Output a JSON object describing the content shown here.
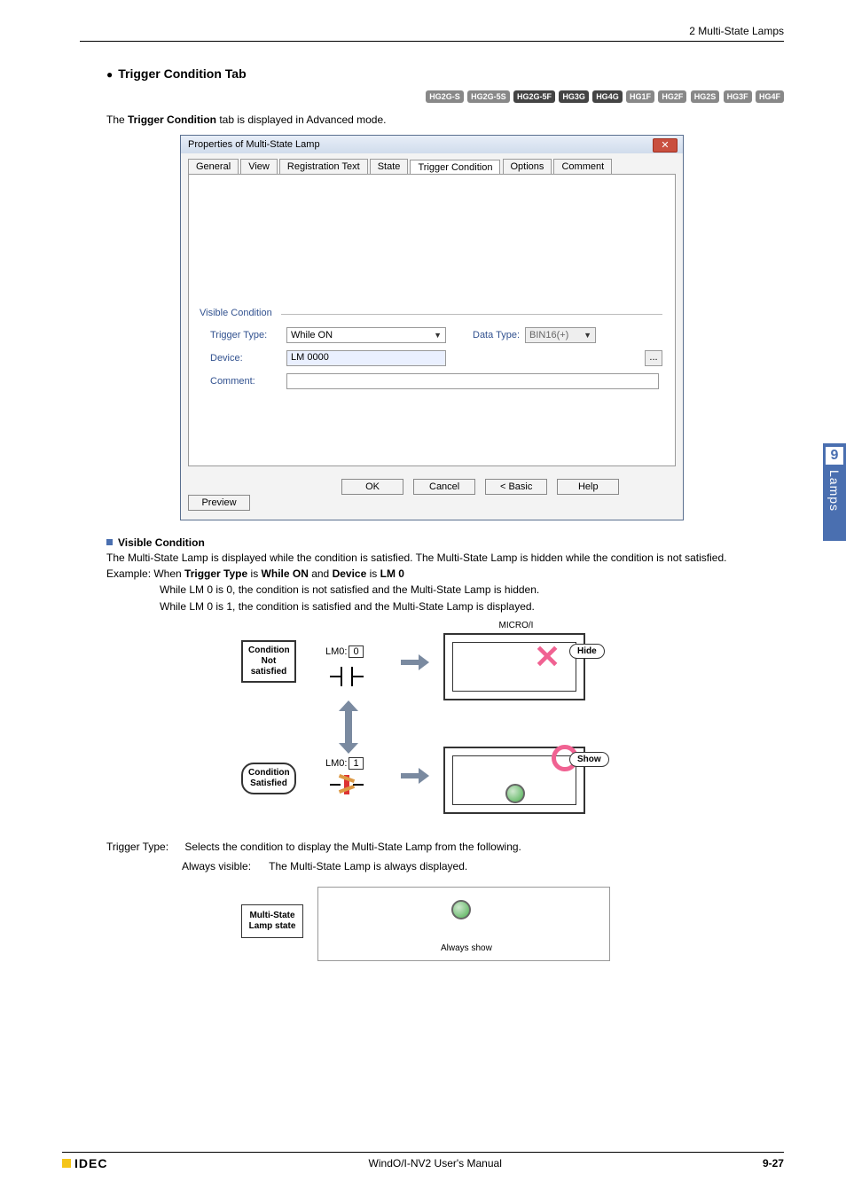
{
  "header": {
    "breadcrumb": "2 Multi-State Lamps"
  },
  "section": {
    "title_prefix": "Trigger Condition",
    "title_suffix": " Tab"
  },
  "badges": [
    "HG2G-S",
    "HG2G-5S",
    "HG2G-5F",
    "HG3G",
    "HG4G",
    "HG1F",
    "HG2F",
    "HG2S",
    "HG3F",
    "HG4F"
  ],
  "intro": {
    "p1a": "The ",
    "p1b": "Trigger Condition",
    "p1c": " tab is displayed in Advanced mode."
  },
  "dialog": {
    "title": "Properties of Multi-State Lamp",
    "tabs": [
      "General",
      "View",
      "Registration Text",
      "State",
      "Trigger Condition",
      "Options",
      "Comment"
    ],
    "active_tab_index": 4,
    "fieldset": "Visible Condition",
    "labels": {
      "trigger": "Trigger Type:",
      "device": "Device:",
      "comment": "Comment:",
      "datatype": "Data Type:"
    },
    "values": {
      "trigger": "While ON",
      "device": "LM 0000",
      "datatype": "BIN16(+)",
      "comment": ""
    },
    "buttons": {
      "ok": "OK",
      "cancel": "Cancel",
      "basic": "< Basic",
      "help": "Help",
      "preview": "Preview"
    },
    "browse": "..."
  },
  "visibleCondition": {
    "heading": "Visible Condition",
    "body": "The Multi-State Lamp is displayed while the condition is satisfied. The Multi-State Lamp is hidden while the condition is not satisfied.",
    "example_prefix": "Example: When ",
    "ex_b1": "Trigger Type",
    "ex_mid1": " is ",
    "ex_b2": "While ON",
    "ex_mid2": " and ",
    "ex_b3": "Device",
    "ex_mid3": " is ",
    "ex_b4": "LM 0",
    "line2": "While LM 0 is 0, the condition is not satisfied and the Multi-State Lamp is hidden.",
    "line3": "While LM 0 is 1, the condition is satisfied and the Multi-State Lamp is displayed."
  },
  "diagram1": {
    "cond_not": "Condition\nNot\nsatisfied",
    "cond_sat": "Condition\nSatisfied",
    "lm0_0_label": "LM0:",
    "lm0_0_val": "0",
    "lm0_1_label": "LM0:",
    "lm0_1_val": "1",
    "microi": "MICRO/I",
    "hide": "Hide",
    "show": "Show"
  },
  "triggerType": {
    "label": "Trigger Type:",
    "desc": "Selects the condition to display the Multi-State Lamp from the following.",
    "always_label": "Always visible:",
    "always_desc": "The Multi-State Lamp is always displayed."
  },
  "diagram2": {
    "boxline1": "Multi-State",
    "boxline2": "Lamp state",
    "caption": "Always show"
  },
  "sidetab": {
    "num": "9",
    "text": "Lamps"
  },
  "footer": {
    "brand": "IDEC",
    "center": "WindO/I-NV2 User's Manual",
    "page": "9-27"
  }
}
